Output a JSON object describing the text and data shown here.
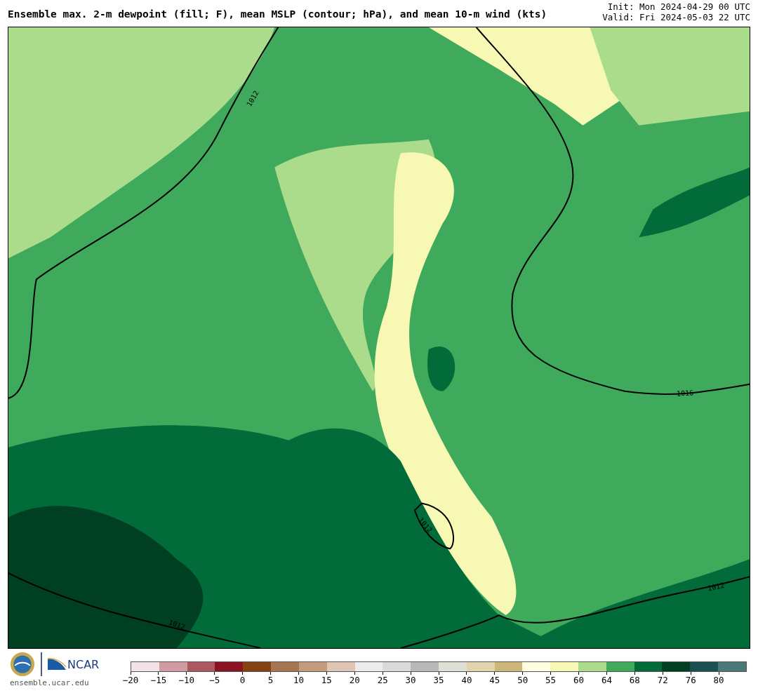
{
  "title": "Ensemble max. 2-m dewpoint (fill; F), mean MSLP (contour; hPa), and mean 10-m wind (kts)",
  "init": "Init: Mon 2024-04-29 00 UTC",
  "valid": "Valid: Fri 2024-05-03 22 UTC",
  "map": {
    "contour_labels": [
      "1012",
      "1016",
      "1012",
      "1012",
      "1012"
    ]
  },
  "footer": {
    "logo_text": "NCAR",
    "url": "ensemble.ucar.edu"
  },
  "colorbar": {
    "bins": [
      {
        "color": "#f2e4e6"
      },
      {
        "color": "#d09ca2"
      },
      {
        "color": "#ab585f"
      },
      {
        "color": "#8b1220"
      },
      {
        "color": "#864212"
      },
      {
        "color": "#a87552"
      },
      {
        "color": "#c39c80"
      },
      {
        "color": "#dfc6b4"
      },
      {
        "color": "#ececec"
      },
      {
        "color": "#dadada"
      },
      {
        "color": "#b8b8b8"
      },
      {
        "color": "#dfe0d3"
      },
      {
        "color": "#e3d3ae"
      },
      {
        "color": "#cdb679"
      },
      {
        "color": "#fefde1"
      },
      {
        "color": "#f6f8b4"
      },
      {
        "color": "#abdc8c"
      },
      {
        "color": "#40aa5c"
      },
      {
        "color": "#016b39"
      },
      {
        "color": "#003f22"
      },
      {
        "color": "#1b5052"
      },
      {
        "color": "#4c7978"
      }
    ],
    "ticks": [
      "−20",
      "−15",
      "−10",
      "−5",
      "0",
      "5",
      "10",
      "15",
      "20",
      "25",
      "30",
      "35",
      "40",
      "45",
      "50",
      "55",
      "60",
      "64",
      "68",
      "72",
      "76",
      "80"
    ]
  }
}
